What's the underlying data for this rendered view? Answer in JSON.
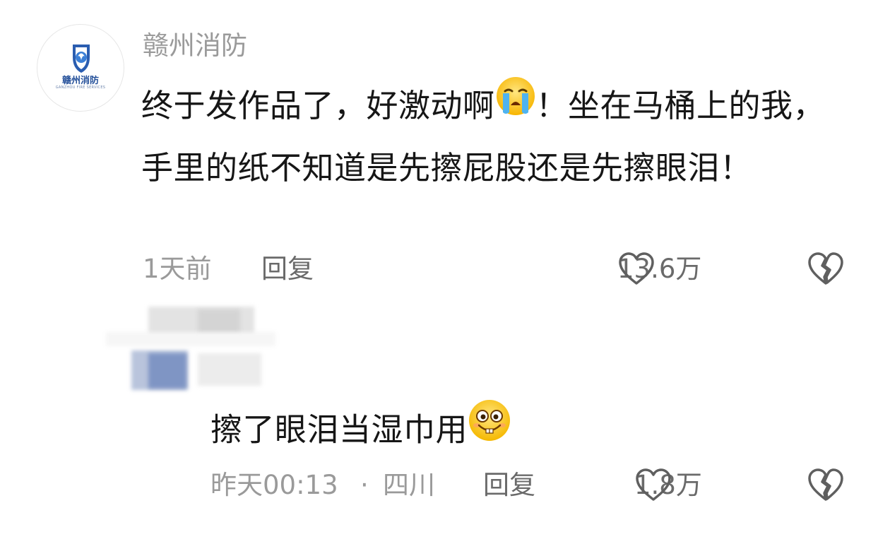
{
  "comment": {
    "author": "赣州消防",
    "avatar_logo_text": "赣州消防",
    "avatar_logo_sub": "GANZHOU FIRE SERVICES",
    "text_before_emoji": "终于发作品了，好激动啊",
    "emoji": "crying-face",
    "text_after_emoji": "！坐在马桶上的我，手里的纸不知道是先擦屁股还是先擦眼泪！",
    "time": "1天前",
    "reply_label": "回复",
    "like_count": "13.6万"
  },
  "reply": {
    "text": "擦了眼泪当湿巾用",
    "emoji": "grinning-buck-teeth-face",
    "time": "昨天00:13",
    "separator": "·",
    "location": "四川",
    "reply_label": "回复",
    "like_count": "1.8万"
  },
  "colors": {
    "text": "#161616",
    "meta": "#9a9a9a",
    "action": "#6a6a6a",
    "logo_blue": "#24509a"
  }
}
